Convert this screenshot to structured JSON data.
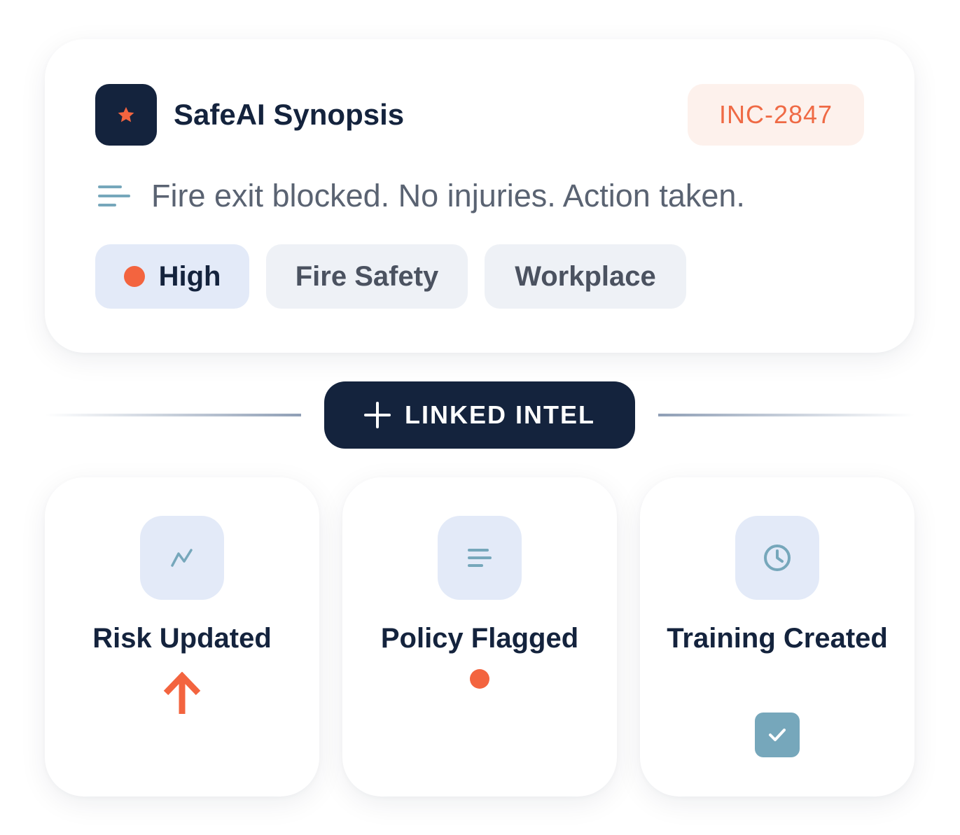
{
  "synopsis": {
    "title": "SafeAI Synopsis",
    "incident_id": "INC-2847",
    "summary": "Fire exit blocked. No injuries. Action taken.",
    "logo_icon": "star-icon",
    "summary_icon": "text-lines-icon",
    "tags": [
      {
        "label": "High",
        "icon": "severity-dot-icon"
      },
      {
        "label": "Fire Safety"
      },
      {
        "label": "Workplace"
      }
    ]
  },
  "linked": {
    "label": "LINKED INTEL",
    "icon": "plus-icon"
  },
  "intel_cards": [
    {
      "label": "Risk Updated",
      "icon": "trend-icon",
      "indicator": "arrow-up-icon"
    },
    {
      "label": "Policy Flagged",
      "icon": "text-lines-icon",
      "indicator": "status-dot-icon"
    },
    {
      "label": "Training Created",
      "icon": "clock-icon",
      "indicator": "checkbox-checked-icon"
    }
  ],
  "colors": {
    "navy": "#14233d",
    "accent_orange": "#f3643f",
    "badge_text": "#ef6a45",
    "badge_bg": "#fdf1ec",
    "icon_blue": "#76a7bb",
    "icon_bg": "#e3eaf8",
    "tag_bg": "#eef1f6"
  }
}
